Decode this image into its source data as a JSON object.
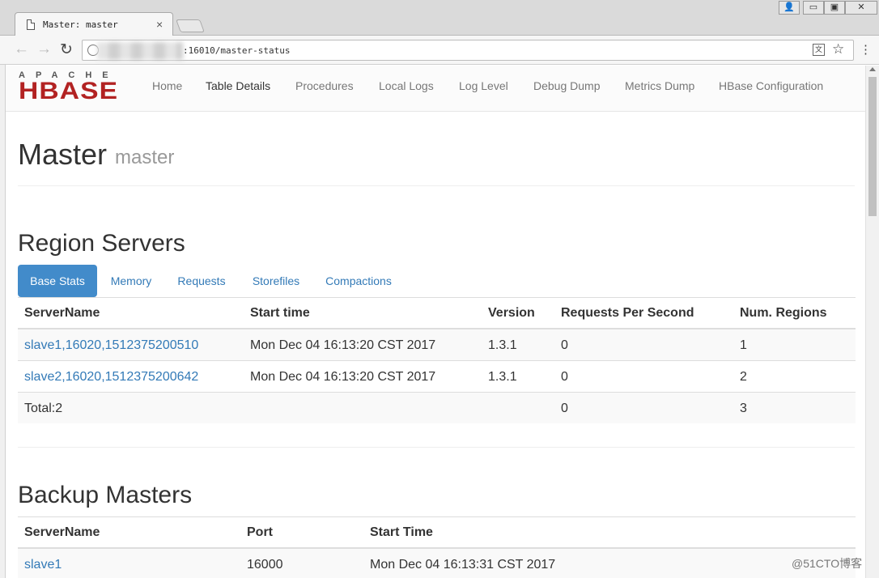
{
  "browser": {
    "tab_title": "Master: master",
    "tab_close": "×",
    "url_suffix": ":16010/master-status",
    "nav_back": "←",
    "nav_forward": "→",
    "nav_reload": "↻",
    "bookmark_star": "☆",
    "menu": "⋮",
    "translate": "文",
    "window_controls": {
      "user": "👤",
      "minimize": "▭",
      "maximize": "▣",
      "close": "✕"
    }
  },
  "navbar": {
    "logo_top": "APACHE",
    "logo_main": "HBASE",
    "links": [
      "Home",
      "Table Details",
      "Procedures",
      "Local Logs",
      "Log Level",
      "Debug Dump",
      "Metrics Dump",
      "HBase Configuration"
    ]
  },
  "header": {
    "title": "Master",
    "subtitle": "master"
  },
  "region_servers": {
    "heading": "Region Servers",
    "tabs": [
      "Base Stats",
      "Memory",
      "Requests",
      "Storefiles",
      "Compactions"
    ],
    "active_tab": "Base Stats",
    "columns": [
      "ServerName",
      "Start time",
      "Version",
      "Requests Per Second",
      "Num. Regions"
    ],
    "rows": [
      {
        "server": "slave1,16020,1512375200510",
        "start": "Mon Dec 04 16:13:20 CST 2017",
        "version": "1.3.1",
        "rps": "0",
        "regions": "1"
      },
      {
        "server": "slave2,16020,1512375200642",
        "start": "Mon Dec 04 16:13:20 CST 2017",
        "version": "1.3.1",
        "rps": "0",
        "regions": "2"
      }
    ],
    "total": {
      "label": "Total:2",
      "rps": "0",
      "regions": "3"
    }
  },
  "backup_masters": {
    "heading": "Backup Masters",
    "columns": [
      "ServerName",
      "Port",
      "Start Time"
    ],
    "rows": [
      {
        "server": "slave1",
        "port": "16000",
        "start": "Mon Dec 04 16:13:31 CST 2017"
      }
    ]
  },
  "watermark": "@51CTO博客",
  "colors": {
    "accent": "#428bca",
    "link": "#337ab7",
    "logo_red": "#b22222"
  }
}
